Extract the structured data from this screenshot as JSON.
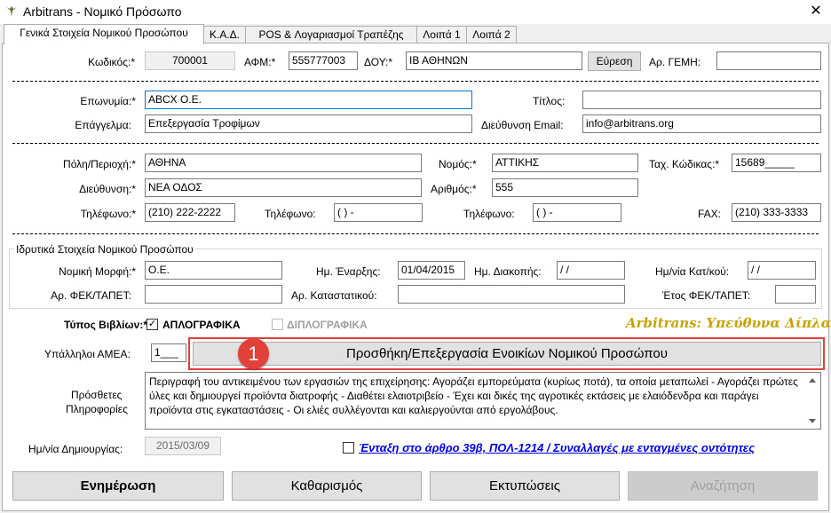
{
  "window": {
    "title": "Arbitrans - Νομικό Πρόσωπο",
    "close": "✕",
    "icon": "bird-logo-icon"
  },
  "tabs": [
    {
      "label": "Γενικά Στοιχεία Νομικού Προσώπου"
    },
    {
      "label": "Κ.Α.Δ."
    },
    {
      "label": "POS & Λογαριασμοί Τραπέζης"
    },
    {
      "label": "Λοιπά 1"
    },
    {
      "label": "Λοιπά 2"
    }
  ],
  "row1": {
    "code_label": "Κωδικός:*",
    "code_value": "700001",
    "afm_label": "ΑΦΜ:*",
    "afm_value": "555777003",
    "doy_label": "ΔΟΥ:*",
    "doy_value": "ΙΒ ΑΘΗΝΩΝ",
    "search_button": "Εύρεση",
    "gemi_label": "Αρ. ΓΕΜΗ:",
    "gemi_value": ""
  },
  "row2": {
    "name_label": "Επωνυμία:*",
    "name_value": "ABCX Ο.Ε.",
    "title_label": "Τίτλος:",
    "title_value": "",
    "profession_label": "Επάγγελμα:",
    "profession_value": "Επεξεργασία Τροφίμων",
    "email_label": "Διεύθυνση Email:",
    "email_value": "info@arbitrans.org"
  },
  "row3": {
    "city_label": "Πόλη/Περιοχή:*",
    "city_value": "ΑΘΗΝΑ",
    "prefecture_label": "Νομός:*",
    "prefecture_value": "ΑΤΤΙΚΗΣ",
    "zip_label": "Ταχ. Κώδικας:*",
    "zip_value": "15689_____",
    "address_label": "Διεύθυνση:*",
    "address_value": "ΝΕΑ ΟΔΟΣ",
    "number_label": "Αριθμός:*",
    "number_value": "555",
    "phone1_label": "Τηλέφωνο:*",
    "phone1_value": "(210) 222-2222",
    "phone2_label": "Τηλέφωνο:",
    "phone2_value": "(   )     -",
    "phone3_label": "Τηλέφωνο:",
    "phone3_value": "(   )     -",
    "fax_label": "FAX:",
    "fax_value": "(210) 333-3333"
  },
  "founding": {
    "legend": "Ιδρυτικά Στοιχεία Νομικού Προσώπου",
    "legal_form_label": "Νομική Μορφή:*",
    "legal_form_value": "Ο.Ε.",
    "start_label": "Ημ. Έναρξης:",
    "start_value": "01/04/2015",
    "stop_label": "Ημ. Διακοπής:",
    "stop_value": " /  /",
    "reg_date_label": "Ημ/νία Κατ/κού:",
    "reg_date_value": " /  /",
    "fek_label": "Αρ. ΦΕΚ/ΤΑΠΕΤ:",
    "fek_value": "",
    "statute_label": "Αρ. Καταστατικού:",
    "statute_value": "",
    "fek_year_label": "Έτος ΦΕΚ/ΤΑΠΕΤ:",
    "fek_year_value": ""
  },
  "books": {
    "label": "Τύπος Βιβλίων:*",
    "simple_label": "ΑΠΛΟΓΡΑΦΙΚΑ",
    "simple_checked": "✓",
    "double_label": "ΔΙΠΛΟΓΡΑΦΙΚΑ",
    "slogan": "Arbitrans: Υπεύθυνα Δίπλα σας"
  },
  "employees": {
    "label": "Υπάλληλοι ΑΜΕΑ:",
    "value": "1___",
    "rent_button": "Προσθήκη/Επεξεργασία Ενοικίων Νομικού Προσώπου",
    "badge": "1"
  },
  "notes": {
    "label_line1": "Πρόσθετες",
    "label_line2": "Πληροφορίες",
    "text": "Περιγραφή του αντικειμένου των εργασιών της επιχείρησης: Αγοράζει εμπορεύματα (κυρίως ποτά), τα οποία μεταπωλεί - Αγοράζει πρώτες ύλες και δημιουργεί προϊόντα διατροφής - Διαθέτει ελαιοτριβείο - Έχει και δικές της αγροτικές εκτάσεις με ελαιόδενδρα και παράγει προϊόντα στις εγκαταστάσεις - Οι ελιές συλλέγονται και καλιεργούνται από εργολάβους."
  },
  "creation": {
    "label": "Ημ/νία Δημιουργίας:",
    "value": "2015/03/09",
    "article_link": "Ένταξη στο άρθρο 39β, ΠΟΛ-1214 / Συναλλαγές με ενταγμένες οντότητες"
  },
  "footer": {
    "update": "Ενημέρωση",
    "clear": "Καθαρισμός",
    "print": "Εκτυπώσεις",
    "search": "Αναζήτηση"
  },
  "colors": {
    "accent": "#0078d7",
    "badge": "#e2413a",
    "slogan": "#c9a400",
    "link": "#0000ee"
  }
}
